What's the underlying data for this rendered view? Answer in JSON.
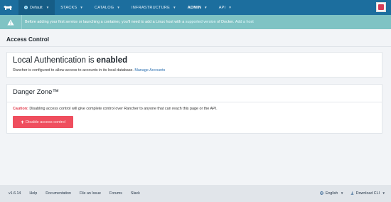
{
  "nav": {
    "environment": "Default",
    "items": [
      {
        "label": "STACKS"
      },
      {
        "label": "CATALOG"
      },
      {
        "label": "INFRASTRUCTURE"
      },
      {
        "label": "ADMIN"
      },
      {
        "label": "API"
      }
    ],
    "active": "ADMIN"
  },
  "banner": {
    "text_before": "Before adding your first service or launching a container, you'll need to add a Linux host with a",
    "link_supported": "supported version",
    "text_middle": "of Docker.",
    "link_add_host": "Add a host"
  },
  "page": {
    "title": "Access Control"
  },
  "local_auth": {
    "title_prefix": "Local Authentication is",
    "title_status": "enabled",
    "description": "Rancher is configured to allow access to accounts in its local database.",
    "manage_link": "Manage Accounts"
  },
  "danger_zone": {
    "title": "Danger Zone™",
    "caution_label": "Caution:",
    "caution_text": "Disabling access control will give complete control over Rancher to anyone that can reach this page or the API.",
    "disable_button": "Disable access control"
  },
  "footer": {
    "version": "v1.6.14",
    "links": [
      "Help",
      "Documentation",
      "File an Issue",
      "Forums",
      "Slack"
    ],
    "language": "English",
    "download": "Download CLI"
  },
  "colors": {
    "nav_bg": "#1c6e9e",
    "banner_bg": "#7fc3c4",
    "danger_button": "#ef4e5e",
    "caution": "#e0394b",
    "link": "#2a6fb0"
  }
}
